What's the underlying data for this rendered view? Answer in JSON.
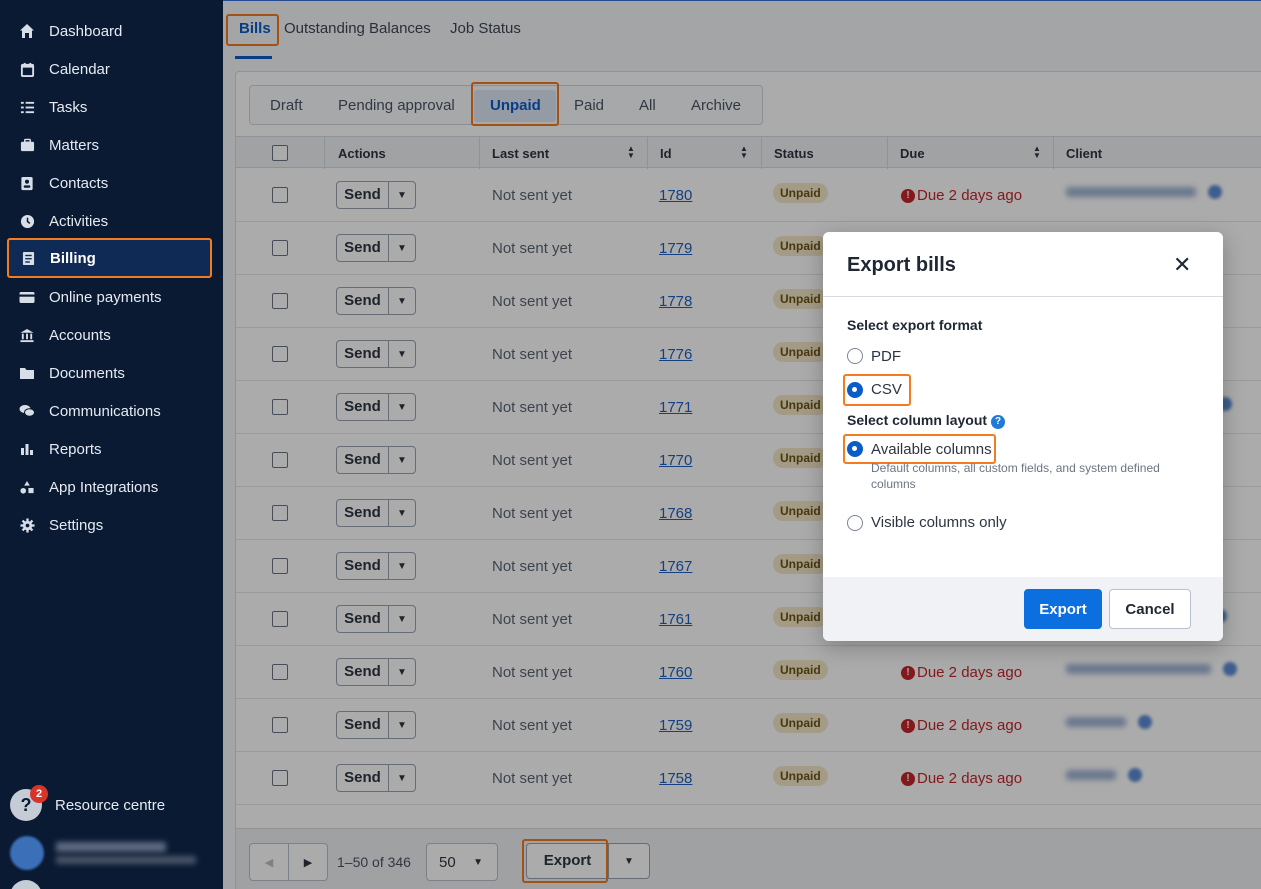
{
  "sidebar": {
    "items": [
      {
        "label": "Dashboard",
        "icon": "home-icon"
      },
      {
        "label": "Calendar",
        "icon": "calendar-icon"
      },
      {
        "label": "Tasks",
        "icon": "list-icon"
      },
      {
        "label": "Matters",
        "icon": "briefcase-icon"
      },
      {
        "label": "Contacts",
        "icon": "contact-card-icon"
      },
      {
        "label": "Activities",
        "icon": "clock-icon"
      },
      {
        "label": "Billing",
        "icon": "invoice-icon"
      },
      {
        "label": "Online payments",
        "icon": "credit-card-icon"
      },
      {
        "label": "Accounts",
        "icon": "bank-icon"
      },
      {
        "label": "Documents",
        "icon": "folder-icon"
      },
      {
        "label": "Communications",
        "icon": "chat-icon"
      },
      {
        "label": "Reports",
        "icon": "bar-chart-icon"
      },
      {
        "label": "App Integrations",
        "icon": "shapes-icon"
      },
      {
        "label": "Settings",
        "icon": "gear-icon"
      }
    ],
    "active": "Billing",
    "resource": {
      "label": "Resource centre",
      "badge": "2"
    }
  },
  "top_tabs": [
    "Bills",
    "Outstanding Balances",
    "Job Status"
  ],
  "sub_tabs": [
    "Draft",
    "Pending approval",
    "Unpaid",
    "Paid",
    "All",
    "Archive"
  ],
  "table": {
    "headers": [
      "Actions",
      "Last sent",
      "Id",
      "Status",
      "Due",
      "Client"
    ],
    "send_label": "Send",
    "last_sent": "Not sent yet",
    "rows": [
      {
        "id": "1780",
        "status": "Unpaid",
        "due": "Due 2 days ago"
      },
      {
        "id": "1779",
        "status": "Unpaid",
        "due": ""
      },
      {
        "id": "1778",
        "status": "Unpaid",
        "due": ""
      },
      {
        "id": "1776",
        "status": "Unpaid",
        "due": ""
      },
      {
        "id": "1771",
        "status": "Unpaid",
        "due": ""
      },
      {
        "id": "1770",
        "status": "Unpaid",
        "due": ""
      },
      {
        "id": "1768",
        "status": "Unpaid",
        "due": ""
      },
      {
        "id": "1767",
        "status": "Unpaid",
        "due": ""
      },
      {
        "id": "1761",
        "status": "Unpaid",
        "due": ""
      },
      {
        "id": "1760",
        "status": "Unpaid",
        "due": "Due 2 days ago"
      },
      {
        "id": "1759",
        "status": "Unpaid",
        "due": "Due 2 days ago"
      },
      {
        "id": "1758",
        "status": "Unpaid",
        "due": "Due 2 days ago"
      }
    ]
  },
  "footer": {
    "range": "1–50 of 346",
    "per_page": "50",
    "export_label": "Export"
  },
  "modal": {
    "title": "Export bills",
    "format_label": "Select export format",
    "formats": [
      "PDF",
      "CSV"
    ],
    "selected_format": "CSV",
    "layout_label": "Select column layout",
    "layouts": [
      "Available columns",
      "Visible columns only"
    ],
    "selected_layout": "Available columns",
    "available_desc": "Default columns, all custom fields, and system defined columns",
    "export_button": "Export",
    "cancel_button": "Cancel"
  },
  "colors": {
    "sidebar_bg": "#0a1a33",
    "accent": "#0b5cc9",
    "highlight": "#f47b20",
    "overdue": "#c3262b"
  }
}
